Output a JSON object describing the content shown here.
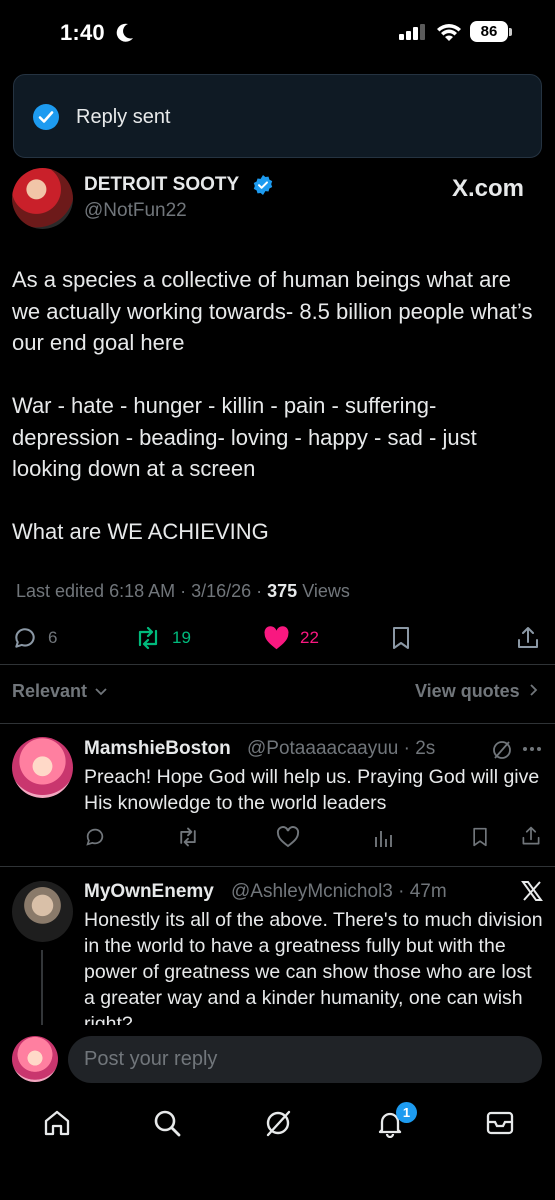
{
  "status_bar": {
    "time": "1:40",
    "battery": "86"
  },
  "toast": {
    "text": "Reply sent"
  },
  "post": {
    "author_name": "DETROIT SOOTY",
    "author_handle": "@NotFun22",
    "source": "X.com",
    "paragraphs": [
      "As a species a collective of human beings what are we actually working towards- 8.5 billion people what’s our end goal here",
      "War - hate - hunger - killin - pain - suffering- depression - beading- loving - happy - sad - just looking down at a screen",
      "What are WE ACHIEVING"
    ],
    "meta_prefix": "Last edited 6:18 AM · 3/16/26 · ",
    "views_count": "375",
    "views_label": " Views",
    "replies": "6",
    "reposts": "19",
    "likes": "22",
    "colors": {
      "repost": "#00ba7c",
      "like": "#f91880",
      "accent": "#1d9bf0"
    }
  },
  "sort": {
    "relevant": "Relevant",
    "view_quotes": "View quotes"
  },
  "replies": [
    {
      "name": "MamshieBoston",
      "handle": "@Potaaaacaayuu · 2s",
      "text": "Preach! Hope God will help us. Praying God will give His knowledge to the world leaders"
    },
    {
      "name": "MyOwnEnemy",
      "handle": "@AshleyMcnichol3 · 47m",
      "text": "Honestly its all of the above. There's to much division in the world to have a greatness fully but with the power of greatness we can show those who are lost a greater way and a kinder humanity, one can wish right?"
    }
  ],
  "compose": {
    "placeholder": "Post your reply"
  },
  "tabbar": {
    "notification_badge": "1"
  }
}
